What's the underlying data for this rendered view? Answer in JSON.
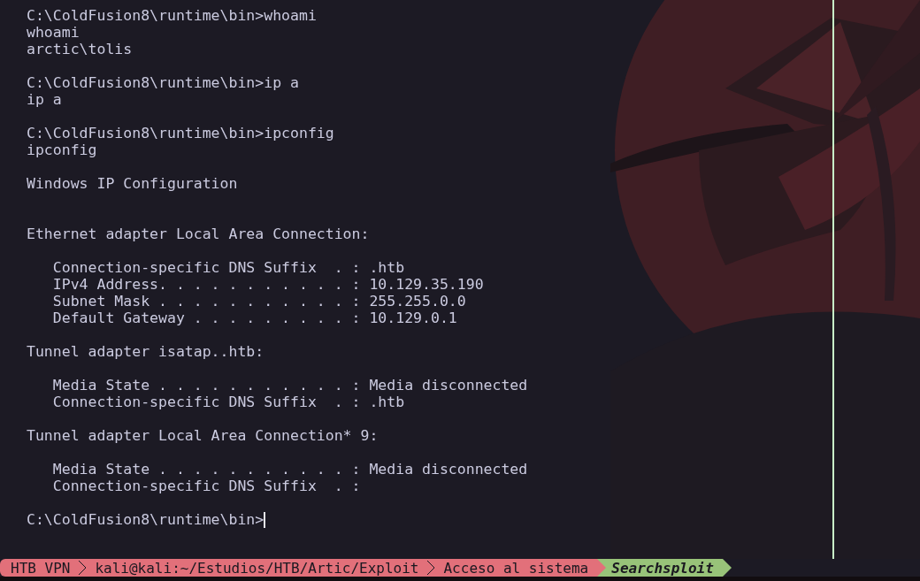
{
  "terminal": {
    "blocks": [
      {
        "kind": "output",
        "lines": [
          "C:\\ColdFusion8\\runtime\\bin>whoami",
          "whoami",
          "arctic\\tolis"
        ]
      },
      {
        "kind": "output",
        "lines": [
          "C:\\ColdFusion8\\runtime\\bin>ip a",
          "ip a"
        ]
      },
      {
        "kind": "output",
        "lines": [
          "C:\\ColdFusion8\\runtime\\bin>ipconfig",
          "ipconfig"
        ]
      },
      {
        "kind": "heading",
        "lines": [
          "Windows IP Configuration"
        ]
      },
      {
        "kind": "output",
        "lines": [
          "Ethernet adapter Local Area Connection:"
        ]
      },
      {
        "kind": "output",
        "lines": [
          "   Connection-specific DNS Suffix  . : .htb",
          "   IPv4 Address. . . . . . . . . . . : 10.129.35.190",
          "   Subnet Mask . . . . . . . . . . . : 255.255.0.0",
          "   Default Gateway . . . . . . . . . : 10.129.0.1"
        ]
      },
      {
        "kind": "output",
        "lines": [
          "Tunnel adapter isatap..htb:"
        ]
      },
      {
        "kind": "output",
        "lines": [
          "   Media State . . . . . . . . . . . : Media disconnected",
          "   Connection-specific DNS Suffix  . : .htb"
        ]
      },
      {
        "kind": "output",
        "lines": [
          "Tunnel adapter Local Area Connection* 9:"
        ]
      },
      {
        "kind": "output",
        "lines": [
          "   Media State . . . . . . . . . . . : Media disconnected",
          "   Connection-specific DNS Suffix  . :"
        ]
      },
      {
        "kind": "prompt",
        "lines": [
          "C:\\ColdFusion8\\runtime\\bin>"
        ]
      }
    ]
  },
  "status_bar": {
    "segments": [
      {
        "label": "HTB VPN",
        "color": "#e2707a"
      },
      {
        "label": "kali@kali:~/Estudios/HTB/Artic/Exploit",
        "color": "#e2707a"
      },
      {
        "label": "Acceso al sistema",
        "color": "#e2707a"
      },
      {
        "label": "Searchsploit",
        "color": "#98c379"
      }
    ]
  }
}
